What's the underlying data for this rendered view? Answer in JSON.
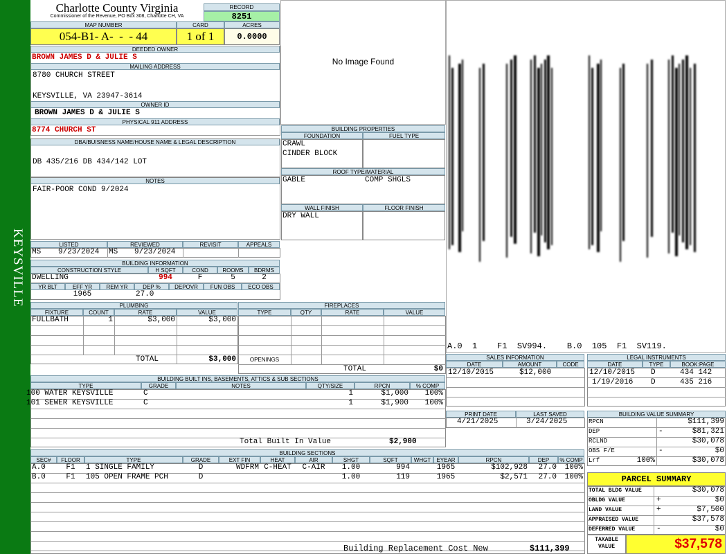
{
  "sidebar": {
    "label": "KEYSVILLE"
  },
  "county": {
    "title": "Charlotte County Virginia",
    "subtitle": "Commissioner of the Revenue, PO Box 308, Charlotte CH, VA"
  },
  "record": {
    "label": "RECORD",
    "value": "8251"
  },
  "map": {
    "label": "MAP NUMBER",
    "value": "054-B1- A-  -  - 44",
    "card_label": "CARD",
    "card": "1 of 1",
    "acres_label": "ACRES",
    "acres": "0.0000"
  },
  "owner": {
    "deeded_label": "DEEDED OWNER",
    "deeded": "BROWN JAMES D & JULIE S",
    "mailing_label": "MAILING ADDRESS",
    "mail1": "8780 CHURCH STREET",
    "mail2": "KEYSVILLE, VA 23947-3614",
    "id_label": "OWNER ID",
    "id": "BROWN JAMES D & JULIE S",
    "phys_label": "PHYSICAL 911 ADDRESS",
    "phys": "8774 CHURCH ST"
  },
  "legal": {
    "label": "DBA/BUISNESS NAME/HOUSE NAME & LEGAL DESCRIPTION",
    "value": "DB 435/216 DB 434/142 LOT"
  },
  "notes": {
    "label": "NOTES",
    "value": "FAIR-POOR COND 9/2024"
  },
  "image": {
    "no_image": "No Image Found"
  },
  "sketch": {
    "caption": "A.0  1    F1  SV994.    B.0  105  F1  SV119."
  },
  "props": {
    "title": "BUILDING PROPERTIES",
    "foundation_label": "FOUNDATION",
    "fuel_label": "FUEL TYPE",
    "foundation1": "CRAWL",
    "foundation2": "CINDER BLOCK",
    "roof_label": "ROOF TYPE/MATERIAL",
    "roof": "GABLE",
    "roof_mat": "COMP SHGLS",
    "wall_label": "WALL FINISH",
    "floor_label": "FLOOR FINISH",
    "wall": "DRY WALL"
  },
  "review": {
    "listed_label": "LISTED",
    "reviewed_label": "REVIEWED",
    "revisit_label": "REVISIT",
    "appeals_label": "APPEALS",
    "listed_by": "MS",
    "listed_date": "9/23/2024",
    "rev_by": "MS",
    "rev_date": "9/23/2024"
  },
  "bldg": {
    "title": "BUILDING INFORMATION",
    "style_label": "CONSTRUCTION STYLE",
    "hsqft_label": "H SQFT",
    "cond_label": "COND",
    "rooms_label": "ROOMS",
    "bdrms_label": "BDRMS",
    "style": "DWELLING",
    "hsqft": "994",
    "cond": "F",
    "rooms": "5",
    "bdrms": "2",
    "yrblt_label": "YR BLT",
    "effyr_label": "EFF YR",
    "remyr_label": "REM YR",
    "dep_label": "DEP %",
    "depovr_label": "DEPOVR",
    "funobs_label": "FUN OBS",
    "ecoobs_label": "ECO OBS",
    "effyr": "1965",
    "dep": "27.0"
  },
  "plumbing": {
    "title": "PLUMBING",
    "fixture_label": "FIXTURE",
    "count_label": "COUNT",
    "rate_label": "RATE",
    "value_label": "VALUE",
    "fixture": "FULLBATH",
    "count": "1",
    "rate": "$3,000",
    "value": "$3,000",
    "total_label": "TOTAL",
    "total": "$3,000"
  },
  "fireplaces": {
    "title": "FIREPLACES",
    "type_label": "TYPE",
    "qty_label": "QTY",
    "rate_label": "RATE",
    "value_label": "VALUE",
    "openings_label": "OPENINGS",
    "total_label": "TOTAL",
    "total": "$0"
  },
  "sales": {
    "title": "SALES INFORMATION",
    "date_label": "DATE",
    "amount_label": "AMOUNT",
    "code_label": "CODE",
    "date": "12/10/2015",
    "amount": "$12,000"
  },
  "legal_inst": {
    "title": "LEGAL INSTRUMENTS",
    "date_label": "DATE",
    "type_label": "TYPE",
    "book_label": "BOOK:PAGE",
    "rows": [
      {
        "date": "12/10/2015",
        "type": "D",
        "book": "434 142"
      },
      {
        "date": "1/19/2016",
        "type": "D",
        "book": "435 216"
      }
    ]
  },
  "builtins": {
    "title": "BUILDING BUILT INS, BASEMENTS, ATTICS & SUB SECTIONS",
    "type_label": "TYPE",
    "grade_label": "GRADE",
    "notes_label": "NOTES",
    "qty_label": "QTY/SIZE",
    "rpcn_label": "RPCN",
    "comp_label": "% COMP",
    "rows": [
      {
        "type": "100 WATER KEYSVILLE",
        "grade": "C",
        "qty": "1",
        "rpcn": "$1,000",
        "comp": "100%"
      },
      {
        "type": "101 SEWER KEYSVILLE",
        "grade": "C",
        "qty": "1",
        "rpcn": "$1,900",
        "comp": "100%"
      }
    ],
    "total_label": "Total Built In Value",
    "total": "$2,900"
  },
  "print": {
    "print_label": "PRINT DATE",
    "saved_label": "LAST SAVED",
    "print_date": "4/21/2025",
    "saved_date": "3/24/2025"
  },
  "bvs": {
    "title": "BUILDING VALUE SUMMARY",
    "rpcn_label": "RPCN",
    "rpcn": "$111,399",
    "dep_label": "DEP",
    "dep_sign": "-",
    "dep": "$81,321",
    "rclnd_label": "RCLND",
    "rclnd": "$30,078",
    "obs_label": "OBS F/E",
    "obs_sign": "-",
    "obs": "$0",
    "lrf_label": "Lrf",
    "lrf_pct": "100%",
    "lrf": "$30,078"
  },
  "sections": {
    "title": "BUILDING SECTIONS",
    "h_sec": "SEC#",
    "h_floor": "FLOOR",
    "h_type": "TYPE",
    "h_grade": "GRADE",
    "h_extfin": "EXT FIN",
    "h_heat": "HEAT",
    "h_air": "AIR",
    "h_shgt": "SHGT",
    "h_sqft": "SQFT",
    "h_whgt": "WHGT",
    "h_eyear": "EYEAR",
    "h_rpcn": "RPCN",
    "h_dep": "DEP",
    "h_comp": "% COMP",
    "rows": [
      {
        "sec": "A.0",
        "floor": "F1",
        "type": "1 SINGLE FAMILY",
        "grade": "D",
        "extfin": "WDFRM",
        "heat": "C-HEAT",
        "air": "C-AIR",
        "shgt": "1.00",
        "sqft": "994",
        "eyear": "1965",
        "rpcn": "$102,928",
        "dep": "27.0",
        "comp": "100%"
      },
      {
        "sec": "B.0",
        "floor": "F1",
        "type": "105 OPEN FRAME PCH",
        "grade": "D",
        "extfin": "",
        "heat": "",
        "air": "",
        "shgt": "1.00",
        "sqft": "119",
        "eyear": "1965",
        "rpcn": "$2,571",
        "dep": "27.0",
        "comp": "100%"
      }
    ],
    "brcn_label": "Building Replacement Cost New",
    "brcn": "$111,399"
  },
  "parcel": {
    "title": "PARCEL SUMMARY",
    "bldg_label": "TOTAL BLDG VALUE",
    "bldg": "$30,078",
    "obldg_label": "OBLDG VALUE",
    "obldg_sign": "+",
    "obldg": "$0",
    "land_label": "LAND VALUE",
    "land_sign": "+",
    "land": "$7,500",
    "appraised_label": "APPRAISED VALUE",
    "appraised": "$37,578",
    "deferred_label": "DEFERRED VALUE",
    "deferred_sign": "-",
    "deferred": "$0",
    "taxable_label1": "TAXABLE",
    "taxable_label2": "VALUE",
    "taxable": "$37,578"
  }
}
